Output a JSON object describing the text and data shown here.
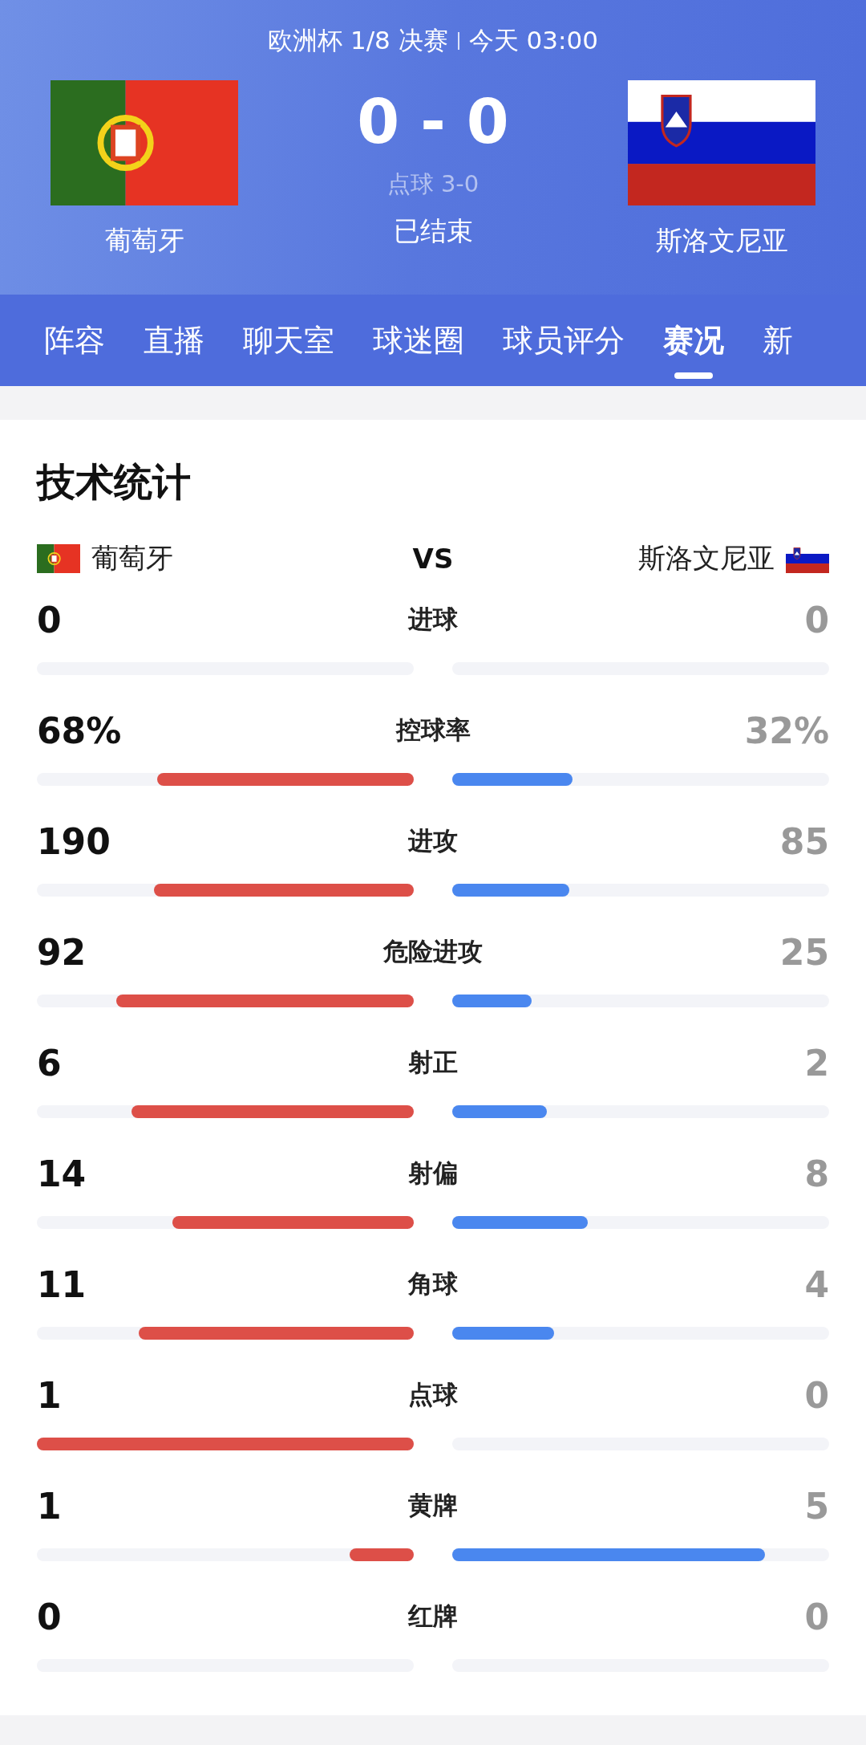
{
  "match": {
    "competition": "欧洲杯 1/8 决赛",
    "time": "今天 03:00",
    "home": {
      "name": "葡萄牙"
    },
    "away": {
      "name": "斯洛文尼亚"
    },
    "score_home": "0",
    "score_away": "0",
    "score_sep": "-",
    "penalties": "点球 3-0",
    "status": "已结束"
  },
  "tabs": [
    {
      "label": "阵容",
      "selected": false
    },
    {
      "label": "直播",
      "selected": false
    },
    {
      "label": "聊天室",
      "selected": false
    },
    {
      "label": "球迷圈",
      "selected": false
    },
    {
      "label": "球员评分",
      "selected": false
    },
    {
      "label": "赛况",
      "selected": true
    },
    {
      "label": "新",
      "selected": false
    }
  ],
  "stats": {
    "title": "技术统计",
    "home": "葡萄牙",
    "vs": "VS",
    "away": "斯洛文尼亚",
    "rows": [
      {
        "label": "进球",
        "home": {
          "value": "0"
        },
        "away": {
          "value": "0"
        }
      },
      {
        "label": "控球率",
        "home": {
          "value": "68%",
          "level": 0.68
        },
        "away": {
          "value": "32%",
          "level": 0.32
        }
      },
      {
        "label": "进攻",
        "home": {
          "value": "190",
          "level": 0.69
        },
        "away": {
          "value": "85",
          "level": 0.31
        }
      },
      {
        "label": "危险进攻",
        "home": {
          "value": "92",
          "level": 0.79
        },
        "away": {
          "value": "25",
          "level": 0.21
        }
      },
      {
        "label": "射正",
        "home": {
          "value": "6",
          "level": 0.75
        },
        "away": {
          "value": "2",
          "level": 0.25
        }
      },
      {
        "label": "射偏",
        "home": {
          "value": "14",
          "level": 0.64
        },
        "away": {
          "value": "8",
          "level": 0.36
        }
      },
      {
        "label": "角球",
        "home": {
          "value": "11",
          "level": 0.73
        },
        "away": {
          "value": "4",
          "level": 0.27
        }
      },
      {
        "label": "点球",
        "home": {
          "value": "1",
          "level": 1
        },
        "away": {
          "value": "0"
        }
      },
      {
        "label": "黄牌",
        "home": {
          "value": "1",
          "level": 0.17
        },
        "away": {
          "value": "5",
          "level": 0.83
        }
      },
      {
        "label": "红牌",
        "home": {
          "value": "0"
        },
        "away": {
          "value": "0"
        }
      }
    ]
  }
}
